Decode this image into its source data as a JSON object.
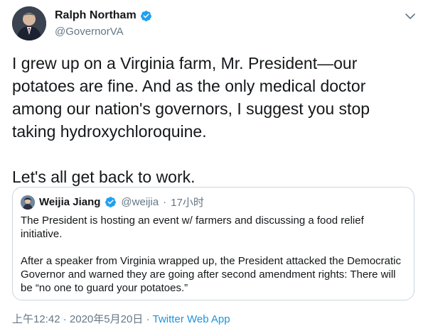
{
  "author": {
    "name": "Ralph Northam",
    "handle": "@GovernorVA"
  },
  "tweet": {
    "paragraph1": "I grew up on a Virginia farm, Mr. President—our potatoes are fine. And as the only medical doctor among our nation's governors, I suggest you stop taking hydroxychloroquine.",
    "paragraph2": "Let's all get back to work."
  },
  "quoted": {
    "name": "Weijia Jiang",
    "handle": "@weijia",
    "separator": "·",
    "time": "17小时",
    "paragraph1": "The President is hosting an event w/ farmers and discussing a food relief initiative.",
    "paragraph2": "After a speaker from Virginia wrapped up, the President attacked the Democratic Governor and warned they are going after second amendment rights: There will be “no one to guard your potatoes.”"
  },
  "footer": {
    "time": "上午12:42",
    "separator1": "·",
    "date": "2020年5月20日",
    "separator2": "·",
    "app": "Twitter Web App"
  },
  "colors": {
    "text": "#14171a",
    "secondary": "#657786",
    "link": "#1b95e0",
    "verified": "#1da1f2",
    "border": "#ccd6dd"
  },
  "icons": {
    "verified": "verified-badge-icon",
    "caret": "chevron-down-icon"
  }
}
